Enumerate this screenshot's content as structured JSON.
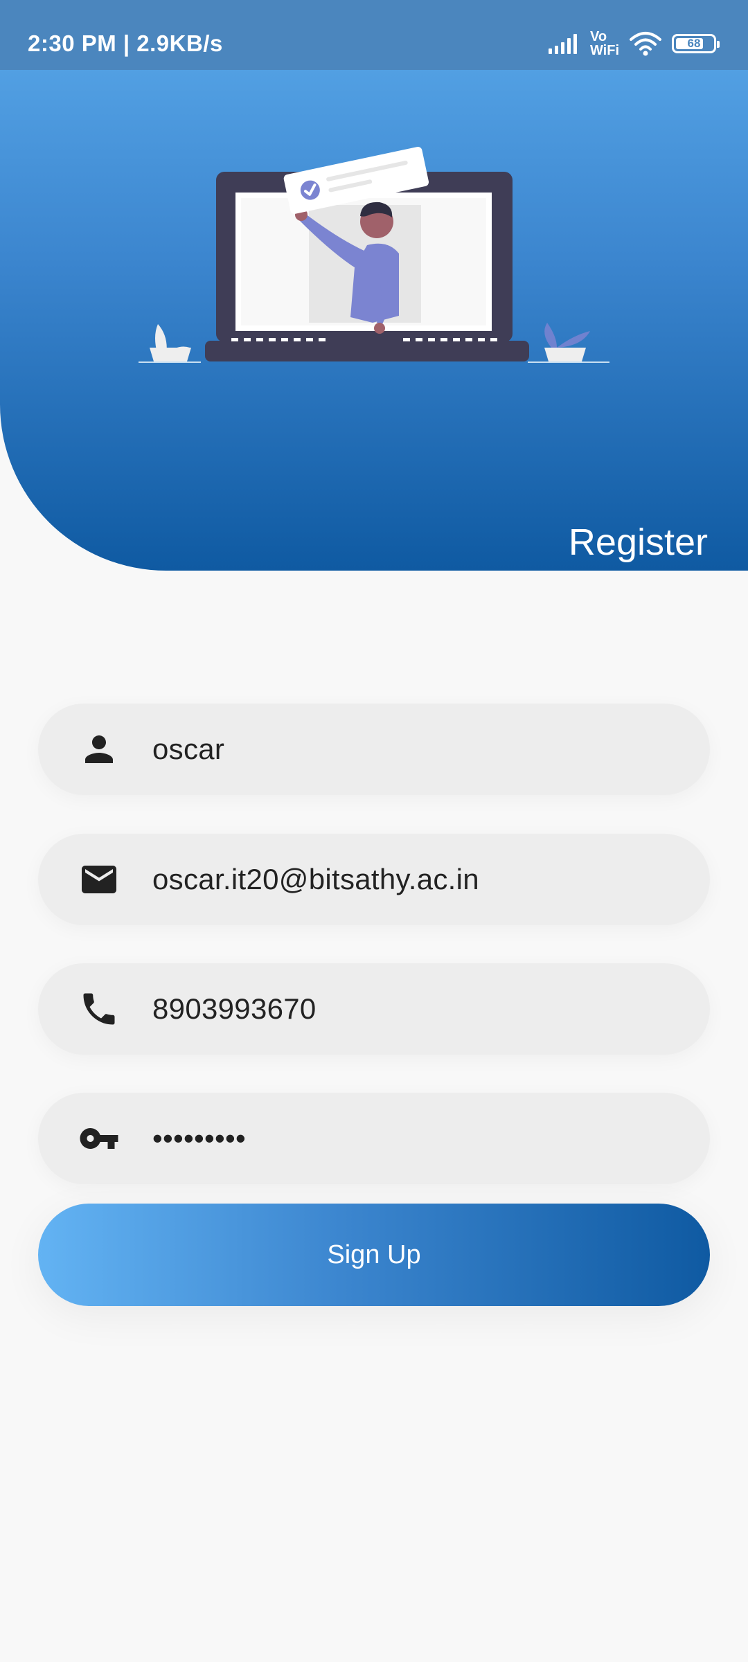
{
  "status_bar": {
    "time": "2:30 PM | 2.9KB/s",
    "vowifi_top": "Vo",
    "vowifi_bottom": "WiFi",
    "battery": "68",
    "icons": [
      "signal-icon",
      "wifi-icon",
      "battery-icon"
    ]
  },
  "header": {
    "title": "Register"
  },
  "form": {
    "name": {
      "icon": "person-icon",
      "value": "oscar"
    },
    "email": {
      "icon": "mail-icon",
      "value": "oscar.it20@bitsathy.ac.in"
    },
    "phone": {
      "icon": "phone-icon",
      "value": "8903993670"
    },
    "password": {
      "icon": "key-icon",
      "value": "•••••••••"
    }
  },
  "buttons": {
    "signup_label": "Sign Up"
  },
  "colors": {
    "primary_light": "#63b3f3",
    "primary": "#3c86cf",
    "primary_dark": "#0f5aa2",
    "field_bg": "#ededed",
    "icon": "#222222"
  }
}
